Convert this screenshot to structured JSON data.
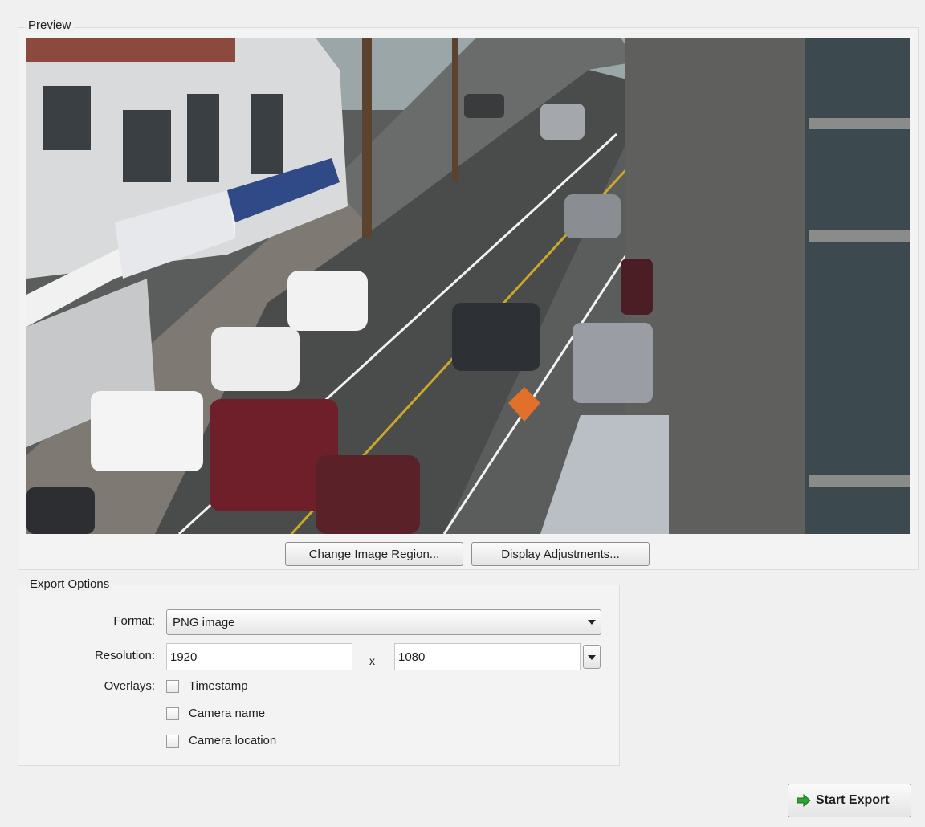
{
  "preview": {
    "title": "Preview",
    "image_description_icon": "camera-preview-image",
    "change_region_label": "Change Image Region...",
    "display_adjustments_label": "Display Adjustments..."
  },
  "export_options": {
    "title": "Export Options",
    "format_label": "Format:",
    "format_value": "PNG image",
    "resolution_label": "Resolution:",
    "resolution_width": "1920",
    "resolution_separator": "x",
    "resolution_height": "1080",
    "overlays_label": "Overlays:",
    "overlays": [
      {
        "label": "Timestamp",
        "checked": false
      },
      {
        "label": "Camera name",
        "checked": false
      },
      {
        "label": "Camera location",
        "checked": false
      }
    ]
  },
  "actions": {
    "start_export_label": "Start Export",
    "start_export_icon": "green-arrow-icon",
    "accent_color": "#2fa32f"
  }
}
